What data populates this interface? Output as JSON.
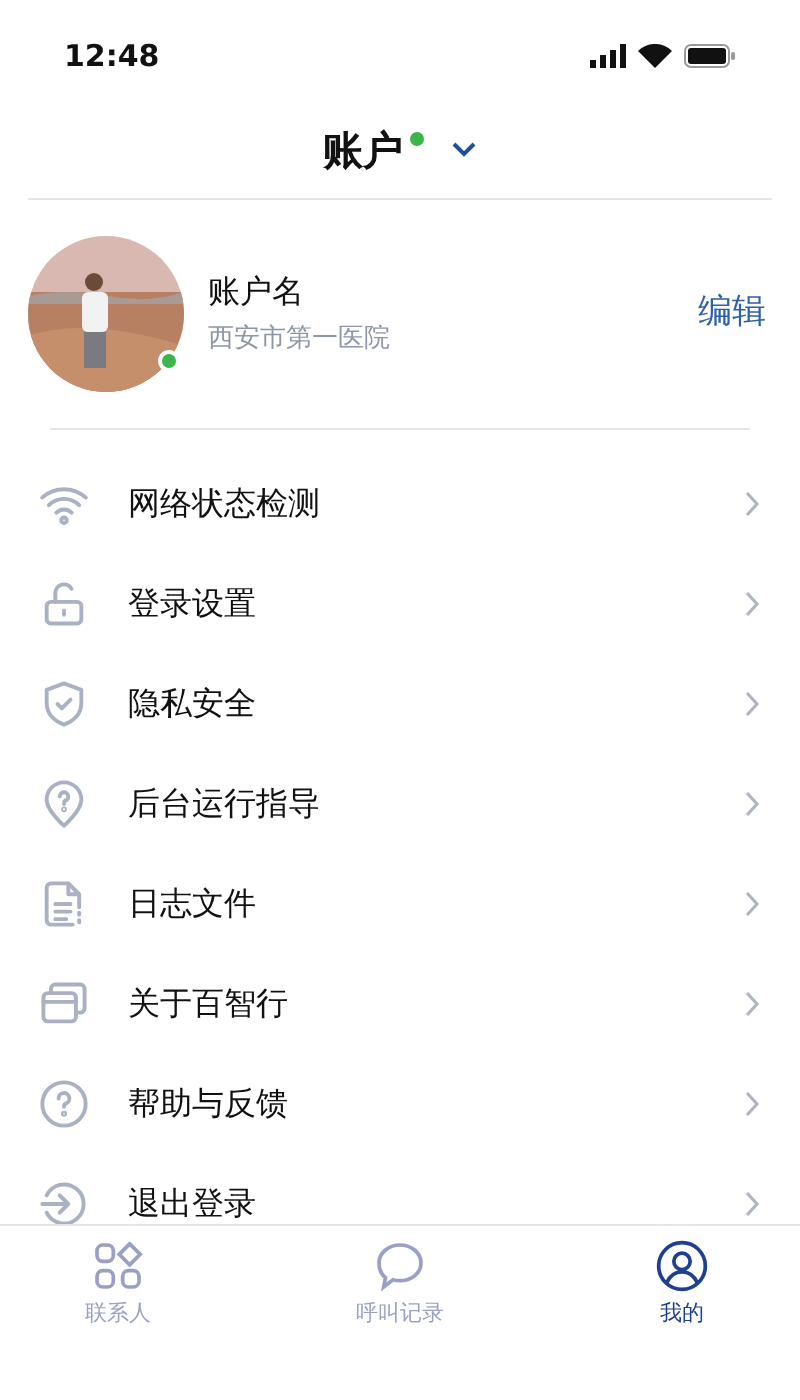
{
  "status_bar": {
    "time": "12:48"
  },
  "header": {
    "title": "账户",
    "online": true
  },
  "profile": {
    "name": "账户名",
    "organization": "西安市第一医院",
    "online": true,
    "edit": "编辑"
  },
  "menu": [
    {
      "label": "网络状态检测"
    },
    {
      "label": "登录设置"
    },
    {
      "label": "隐私安全"
    },
    {
      "label": "后台运行指导"
    },
    {
      "label": "日志文件"
    },
    {
      "label": "关于百智行"
    },
    {
      "label": "帮助与反馈"
    },
    {
      "label": "退出登录"
    }
  ],
  "tab_bar": [
    {
      "label": "联系人",
      "selected": false
    },
    {
      "label": "呼叫记录",
      "selected": false
    },
    {
      "label": "我的",
      "selected": true
    }
  ]
}
